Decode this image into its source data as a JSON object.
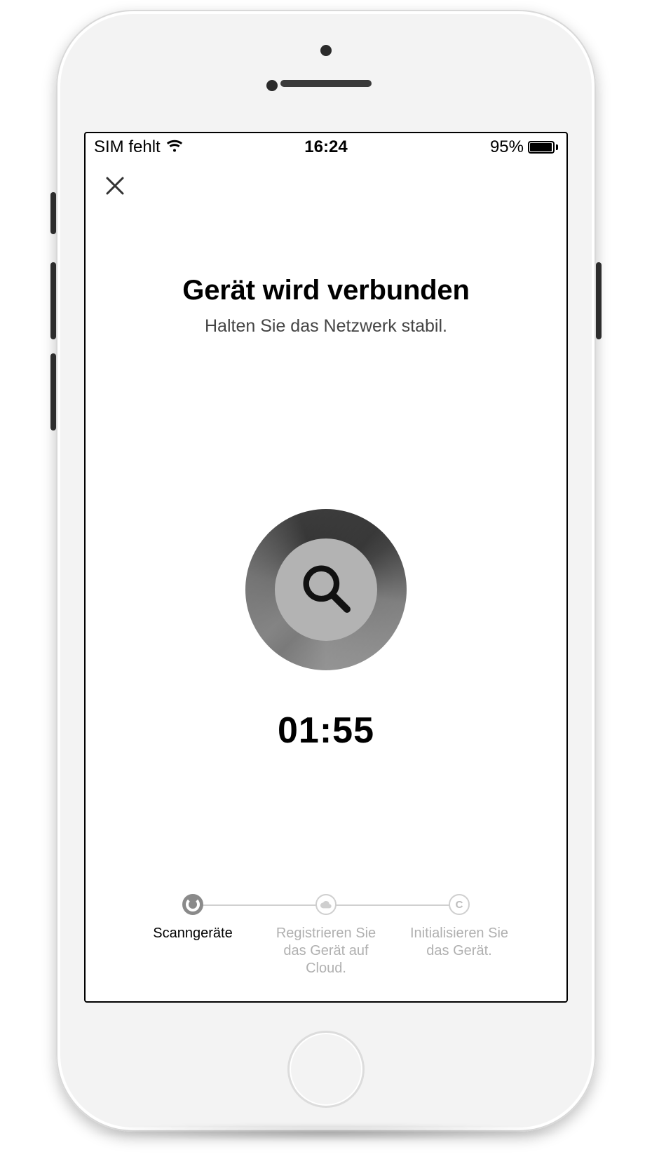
{
  "statusbar": {
    "carrier": "SIM fehlt",
    "time": "16:24",
    "battery_pct": "95%"
  },
  "header": {
    "title": "Gerät wird verbunden",
    "subtitle": "Halten Sie das Netzwerk stabil."
  },
  "timer": "01:55",
  "steps": [
    {
      "label": "Scanngeräte",
      "state": "active",
      "icon": "spinner"
    },
    {
      "label": "Registrieren Sie das Gerät auf Cloud.",
      "state": "inactive",
      "icon": "cloud"
    },
    {
      "label": "Initialisieren Sie das Gerät.",
      "state": "inactive",
      "icon": "letter-c"
    }
  ]
}
